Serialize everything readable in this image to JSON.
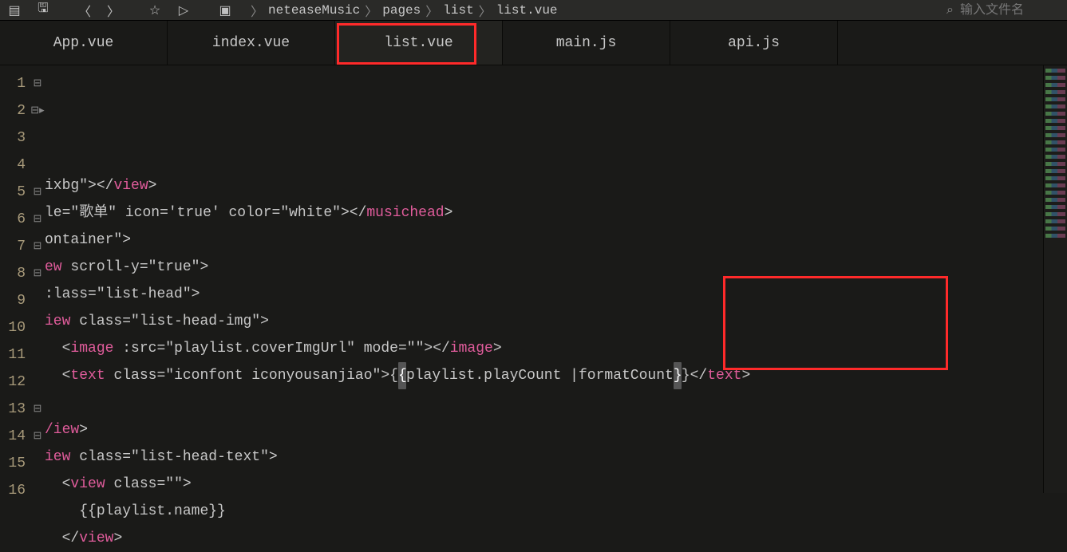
{
  "toolbar": {
    "breadcrumbs": [
      "neteaseMusic",
      "pages",
      "list",
      "list.vue"
    ],
    "search_placeholder": "输入文件名"
  },
  "tabs": [
    {
      "label": "App.vue"
    },
    {
      "label": "index.vue"
    },
    {
      "label": "list.vue",
      "active": true
    },
    {
      "label": "main.js"
    },
    {
      "label": "api.js"
    }
  ],
  "code_lines": [
    {
      "n": 1,
      "fold": "⊟",
      "raw": ""
    },
    {
      "n": 2,
      "fold": "⊟▸",
      "raw": ""
    },
    {
      "n": 3,
      "fold": "",
      "html": "<span class='c-attr'>ixbg\"</span><span class='c-punct'>&gt;</span><span class='c-punct'>&lt;/</span><span class='c-tag'>view</span><span class='c-punct'>&gt;</span>"
    },
    {
      "n": 4,
      "fold": "",
      "html": "<span class='c-attr'>le</span><span class='c-punct'>=</span><span class='c-str'>\"歌单\"</span> <span class='c-attr'>icon</span><span class='c-punct'>=</span><span class='c-str'>'true'</span> <span class='c-attr'>color</span><span class='c-punct'>=</span><span class='c-str'>\"white\"</span><span class='c-punct'>&gt;</span><span class='c-punct'>&lt;/</span><span class='c-tag'>musichead</span><span class='c-punct'>&gt;</span>"
    },
    {
      "n": 5,
      "fold": "⊟",
      "html": "<span class='c-attr'>ontainer\"</span><span class='c-punct'>&gt;</span>"
    },
    {
      "n": 6,
      "fold": "⊟",
      "html": "<span class='c-tag'>ew</span> <span class='c-attr'>scroll-y</span><span class='c-punct'>=</span><span class='c-str'>\"true\"</span><span class='c-punct'>&gt;</span>"
    },
    {
      "n": 7,
      "fold": "⊟",
      "html": "<span class='c-attr'>:lass</span><span class='c-punct'>=</span><span class='c-str'>\"list-head\"</span><span class='c-punct'>&gt;</span>"
    },
    {
      "n": 8,
      "fold": "⊟",
      "html": "<span class='c-tag'>iew</span> <span class='c-attr'>class</span><span class='c-punct'>=</span><span class='c-str'>\"list-head-img\"</span><span class='c-punct'>&gt;</span>"
    },
    {
      "n": 9,
      "fold": "",
      "indent": 1,
      "html": "<span class='c-punct'>&lt;</span><span class='c-tag'>image</span> <span class='c-attr'>:src</span><span class='c-punct'>=</span><span class='c-str'>\"playlist.coverImgUrl\"</span> <span class='c-attr'>mode</span><span class='c-punct'>=</span><span class='c-str'>\"\"</span><span class='c-punct'>&gt;</span><span class='c-punct'>&lt;/</span><span class='c-tag'>image</span><span class='c-punct'>&gt;</span>"
    },
    {
      "n": 10,
      "fold": "",
      "indent": 1,
      "html": "<span class='c-punct'>&lt;</span><span class='c-tag'>text</span> <span class='c-attr'>class</span><span class='c-punct'>=</span><span class='c-str'>\"iconfont iconyousanjiao\"</span><span class='c-punct'>&gt;</span><span class='c-expr'>{<span class='hl-bracket'>{</span>playlist.playCount |formatCount<span class='hl-bracket'>}</span>}</span><span class='c-punct'>&lt;/</span><span class='c-tag'>text</span><span class='c-punct'>&gt;</span>"
    },
    {
      "n": 11,
      "fold": "",
      "raw": ""
    },
    {
      "n": 12,
      "fold": "",
      "html": "<span class='c-tag'>/iew</span><span class='c-punct'>&gt;</span>"
    },
    {
      "n": 13,
      "fold": "⊟",
      "html": "<span class='c-tag'>iew</span> <span class='c-attr'>class</span><span class='c-punct'>=</span><span class='c-str'>\"list-head-text\"</span><span class='c-punct'>&gt;</span>"
    },
    {
      "n": 14,
      "fold": "⊟",
      "indent": 1,
      "html": "<span class='c-punct'>&lt;</span><span class='c-tag'>view</span> <span class='c-attr'>class</span><span class='c-punct'>=</span><span class='c-str'>\"\"</span><span class='c-punct'>&gt;</span>"
    },
    {
      "n": 15,
      "fold": "",
      "indent": 2,
      "html": "<span class='c-expr'>{{playlist.name}}</span>"
    },
    {
      "n": 16,
      "fold": "",
      "indent": 1,
      "html": "<span class='c-punct'>&lt;/</span><span class='c-tag'>view</span><span class='c-punct'>&gt;</span>"
    }
  ]
}
